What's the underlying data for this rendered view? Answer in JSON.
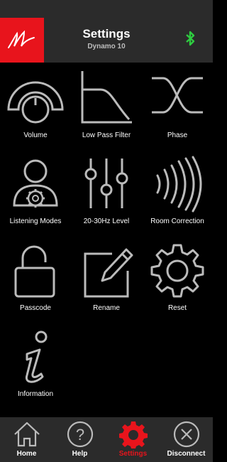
{
  "header": {
    "title": "Settings",
    "subtitle": "Dynamo 10",
    "logo_icon": "brand-signature-logo",
    "status_icon": "bluetooth-icon",
    "status_color": "#2ecc40",
    "brand_color": "#e8141c"
  },
  "tiles": [
    {
      "label": "Volume",
      "icon": "volume-dial-icon"
    },
    {
      "label": "Low Pass Filter",
      "icon": "low-pass-filter-icon"
    },
    {
      "label": "Phase",
      "icon": "phase-icon"
    },
    {
      "label": "Listening Modes",
      "icon": "listening-modes-icon"
    },
    {
      "label": "20-30Hz Level",
      "icon": "level-sliders-icon"
    },
    {
      "label": "Room Correction",
      "icon": "room-correction-icon"
    },
    {
      "label": "Passcode",
      "icon": "padlock-icon"
    },
    {
      "label": "Rename",
      "icon": "rename-pencil-icon"
    },
    {
      "label": "Reset",
      "icon": "reset-gear-icon"
    },
    {
      "label": "Information",
      "icon": "information-icon"
    }
  ],
  "tabbar": {
    "items": [
      {
        "label": "Home",
        "icon": "home-icon",
        "active": false
      },
      {
        "label": "Help",
        "icon": "help-icon",
        "active": false
      },
      {
        "label": "Settings",
        "icon": "settings-gear-icon",
        "active": true
      },
      {
        "label": "Disconnect",
        "icon": "disconnect-icon",
        "active": false
      }
    ],
    "active_color": "#e8141c"
  }
}
